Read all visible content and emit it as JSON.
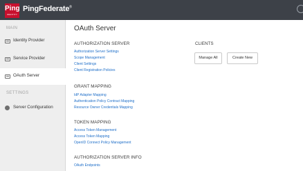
{
  "header": {
    "logo_text": "Ping",
    "logo_subtext": "IDENTITY",
    "product_name": "PingFederate",
    "trademark": "®",
    "user_icon": "user-icon"
  },
  "sidebar": {
    "main_label": "MAIN",
    "items": [
      {
        "label": "Identity Provider",
        "icon": "identity-provider-icon"
      },
      {
        "label": "Service Provider",
        "icon": "service-provider-icon"
      },
      {
        "label": "OAuth Server",
        "icon": "oauth-server-icon"
      }
    ],
    "settings_label": "SETTINGS",
    "settings_items": [
      {
        "label": "Server Configuration",
        "icon": "gear-icon"
      }
    ],
    "active_item": "OAuth Server"
  },
  "main": {
    "title": "OAuth Server",
    "authorization_server": {
      "heading": "AUTHORIZATION SERVER",
      "links": [
        "Authorization Server Settings",
        "Scope Management",
        "Client Settings",
        "Client Registration Policies"
      ]
    },
    "clients": {
      "heading": "CLIENTS",
      "manage_all": "Manage All",
      "create_new": "Create New"
    },
    "grant_mapping": {
      "heading": "GRANT MAPPING",
      "links": [
        "IdP Adapter Mapping",
        "Authentication Policy Contract Mapping",
        "Resource Owner Credentials Mapping"
      ]
    },
    "token_mapping": {
      "heading": "TOKEN MAPPING",
      "links": [
        "Access Token Management",
        "Access Token Mapping",
        "OpenID Connect Policy Management"
      ]
    },
    "authorization_server_info": {
      "heading": "AUTHORIZATION SERVER INFO",
      "links": [
        "OAuth Endpoints"
      ]
    }
  },
  "colors": {
    "topbar": "#3d4148",
    "brand_red": "#c8102e",
    "sidebar_bg": "#eeeeee",
    "link": "#1e6ec8"
  }
}
